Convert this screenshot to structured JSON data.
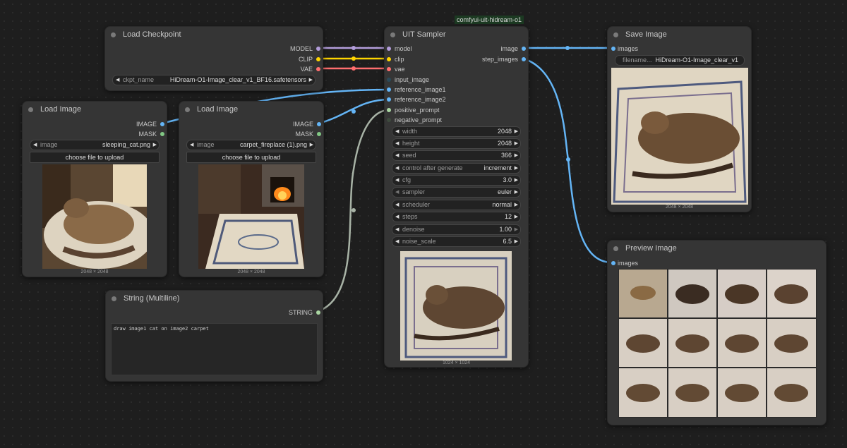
{
  "group": {
    "title": "comfyui-uit-hidream-o1"
  },
  "load_checkpoint": {
    "title": "Load Checkpoint",
    "outputs": [
      "MODEL",
      "CLIP",
      "VAE"
    ],
    "ckpt_label": "ckpt_name",
    "ckpt_value": "HiDream-O1-Image_clear_v1_BF16.safetensors"
  },
  "load_image_1": {
    "title": "Load Image",
    "outputs": [
      "IMAGE",
      "MASK"
    ],
    "image_label": "image",
    "image_value": "sleeping_cat.png",
    "upload_label": "choose file to upload",
    "size": "2048 × 2048"
  },
  "load_image_2": {
    "title": "Load Image",
    "outputs": [
      "IMAGE",
      "MASK"
    ],
    "image_label": "image",
    "image_value": "carpet_fireplace (1).png",
    "upload_label": "choose file to upload",
    "size": "2048 × 2048"
  },
  "string_node": {
    "title": "String (Multiline)",
    "output": "STRING",
    "text": "draw image1 cat on image2 carpet"
  },
  "sampler": {
    "title": "UIT Sampler",
    "inputs": [
      "model",
      "clip",
      "vae",
      "input_image",
      "reference_image1",
      "reference_image2",
      "positive_prompt",
      "negative_prompt"
    ],
    "outputs": [
      "image",
      "step_images"
    ],
    "widgets": [
      {
        "label": "width",
        "value": "2048"
      },
      {
        "label": "height",
        "value": "2048"
      },
      {
        "label": "seed",
        "value": "366"
      },
      {
        "label": "control after generate",
        "value": "increment"
      },
      {
        "label": "cfg",
        "value": "3.0"
      },
      {
        "label": "sampler",
        "value": "euler"
      },
      {
        "label": "scheduler",
        "value": "normal"
      },
      {
        "label": "steps",
        "value": "12"
      },
      {
        "label": "denoise",
        "value": "1.00"
      },
      {
        "label": "noise_scale",
        "value": "6.5"
      }
    ],
    "size": "1024 × 1024"
  },
  "save_image": {
    "title": "Save Image",
    "input": "images",
    "filename_label": "filename...",
    "filename_value": "HiDream-O1-Image_clear_v1",
    "size": "2048 × 2048"
  },
  "preview_image": {
    "title": "Preview Image",
    "input": "images"
  },
  "colors": {
    "model": "#b39ddb",
    "clip": "#ffd500",
    "vae": "#ff6e6e",
    "image": "#64b5f6",
    "mask": "#81c784",
    "string": "#aad6a2",
    "link_string": "#a8b3a6"
  }
}
